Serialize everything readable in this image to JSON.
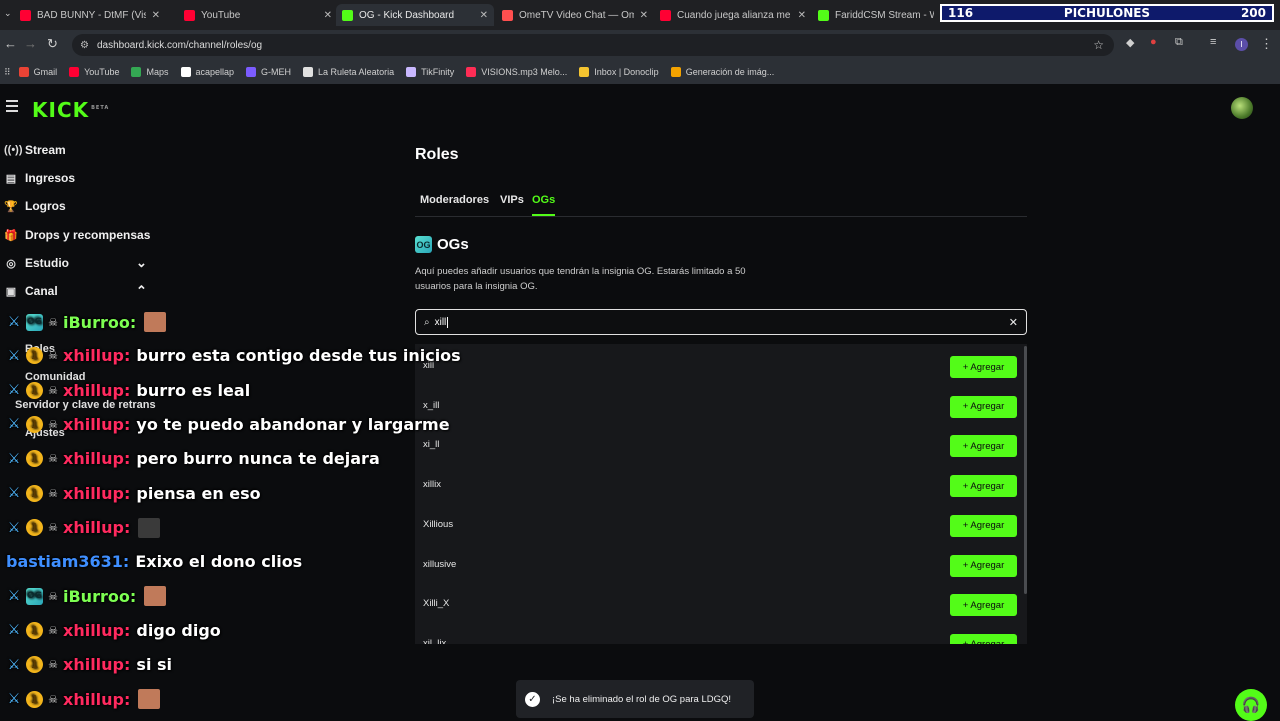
{
  "browser": {
    "tabs": [
      {
        "title": "BAD BUNNY - DtMF (Visualizer)",
        "color": "#ff0033"
      },
      {
        "title": "YouTube",
        "color": "#ff0033"
      },
      {
        "title": "OG - Kick Dashboard",
        "color": "#53fc18"
      },
      {
        "title": "OmeTV Video Chat — Ome",
        "color": "#ff4f4f"
      },
      {
        "title": "Cuando juega alianza me da pena",
        "color": "#ff0033"
      },
      {
        "title": "FariddCSM Stream - Watch Live",
        "color": "#53fc18"
      }
    ],
    "url": "dashboard.kick.com/channel/roles/og",
    "bookmarks": [
      "Gmail",
      "YouTube",
      "Maps",
      "acapellap",
      "G-MEH",
      "La Ruleta Aleatoria",
      "TikFinity",
      "VISIONS.mp3 Melo...",
      "Inbox | Donoclip",
      "Generación de imág..."
    ]
  },
  "overlay": {
    "left": "116",
    "center": "PICHULONES",
    "right": "200"
  },
  "kick": {
    "logo": "KICK",
    "beta": "BETA"
  },
  "sidebar": {
    "items": [
      {
        "label": "Stream",
        "icon": "broadcast-icon"
      },
      {
        "label": "Ingresos",
        "icon": "bank-icon"
      },
      {
        "label": "Logros",
        "icon": "trophy-icon"
      },
      {
        "label": "Drops y recompensas",
        "icon": "gift-icon"
      },
      {
        "label": "Estudio",
        "icon": "camera-icon"
      },
      {
        "label": "Canal",
        "icon": "channel-icon"
      }
    ],
    "subitems": [
      "Roles",
      "Comunidad",
      "Servidor y clave de retrans",
      "Ajustes"
    ]
  },
  "main": {
    "title": "Roles",
    "tabs": [
      "Moderadores",
      "VIPs",
      "OGs"
    ],
    "section_title": "OGs",
    "description": "Aquí puedes añadir usuarios que tendrán la insignia OG. Estarás limitado a 50 usuarios para la insignia OG.",
    "search_value": "xill",
    "add_label": "+ Agregar",
    "results": [
      "xill",
      "x_ill",
      "xi_ll",
      "xillix",
      "Xillious",
      "xillusive",
      "Xilli_X",
      "xil_lix"
    ]
  },
  "chat": [
    {
      "badges": [
        "sword",
        "og",
        "skull"
      ],
      "user": "iBurroo",
      "color": "#7dff52",
      "text": "",
      "emote": "#c07a5a"
    },
    {
      "badges": [
        "sword",
        "coin",
        "skull"
      ],
      "user": "xhillup",
      "color": "#ff2a5f",
      "text": "burro esta contigo desde tus inicios"
    },
    {
      "badges": [
        "sword",
        "coin",
        "skull"
      ],
      "user": "xhillup",
      "color": "#ff2a5f",
      "text": "burro es leal"
    },
    {
      "badges": [
        "sword",
        "coin",
        "skull"
      ],
      "user": "xhillup",
      "color": "#ff2a5f",
      "text": "yo te puedo abandonar y largarme"
    },
    {
      "badges": [
        "sword",
        "coin",
        "skull"
      ],
      "user": "xhillup",
      "color": "#ff2a5f",
      "text": "pero burro nunca te dejara"
    },
    {
      "badges": [
        "sword",
        "coin",
        "skull"
      ],
      "user": "xhillup",
      "color": "#ff2a5f",
      "text": "piensa en eso"
    },
    {
      "badges": [
        "sword",
        "coin",
        "skull"
      ],
      "user": "xhillup",
      "color": "#ff2a5f",
      "text": "",
      "emote": "#3a3a3a"
    },
    {
      "badges": [],
      "user": "bastiam3631",
      "color": "#3f8fff",
      "text": "Exixo el dono clios"
    },
    {
      "badges": [
        "sword",
        "og",
        "skull"
      ],
      "user": "iBurroo",
      "color": "#7dff52",
      "text": "",
      "emote": "#c07a5a"
    },
    {
      "badges": [
        "sword",
        "coin",
        "skull"
      ],
      "user": "xhillup",
      "color": "#ff2a5f",
      "text": "digo digo"
    },
    {
      "badges": [
        "sword",
        "coin",
        "skull"
      ],
      "user": "xhillup",
      "color": "#ff2a5f",
      "text": "si si"
    },
    {
      "badges": [
        "sword",
        "coin",
        "skull"
      ],
      "user": "xhillup",
      "color": "#ff2a5f",
      "text": "",
      "emote": "#c07a5a"
    }
  ],
  "toast": {
    "text": "¡Se ha eliminado el rol de OG para LDGQ!"
  },
  "colors": {
    "accent": "#53fc18",
    "background": "#0b0c0e"
  }
}
